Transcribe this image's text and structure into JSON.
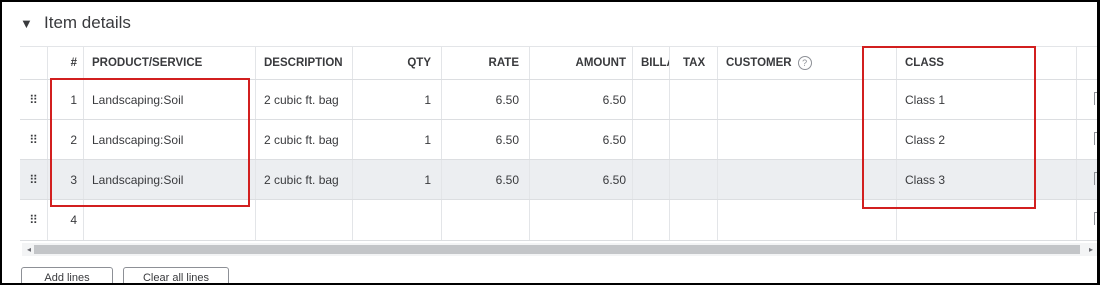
{
  "section": {
    "caret": "▼",
    "title": "Item details"
  },
  "columns": {
    "num": "#",
    "product": "PRODUCT/SERVICE",
    "description": "DESCRIPTION",
    "qty": "QTY",
    "rate": "RATE",
    "amount": "AMOUNT",
    "billable": "BILLA",
    "tax": "TAX",
    "customer": "CUSTOMER",
    "class": "CLASS"
  },
  "help_glyph": "?",
  "rows": [
    {
      "num": "1",
      "product": "Landscaping:Soil",
      "description": "2 cubic ft. bag",
      "qty": "1",
      "rate": "6.50",
      "amount": "6.50",
      "class": "Class 1"
    },
    {
      "num": "2",
      "product": "Landscaping:Soil",
      "description": "2 cubic ft. bag",
      "qty": "1",
      "rate": "6.50",
      "amount": "6.50",
      "class": "Class 2"
    },
    {
      "num": "3",
      "product": "Landscaping:Soil",
      "description": "2 cubic ft. bag",
      "qty": "1",
      "rate": "6.50",
      "amount": "6.50",
      "class": "Class 3"
    },
    {
      "num": "4",
      "product": "",
      "description": "",
      "qty": "",
      "rate": "",
      "amount": "",
      "class": ""
    }
  ],
  "drag_glyph": "⠿",
  "scroll": {
    "left": "◂",
    "right": "▸"
  },
  "buttons": {
    "add_lines": "Add lines",
    "clear_all": "Clear all lines"
  },
  "highlight_color": "#d21f1f"
}
